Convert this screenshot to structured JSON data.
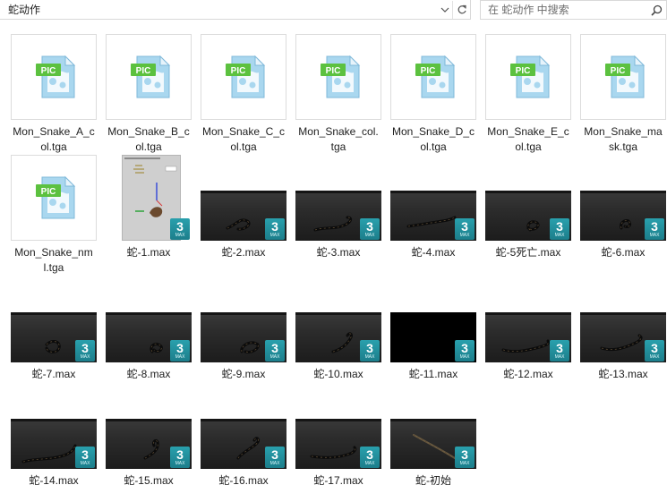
{
  "address_bar": {
    "path": "蛇动作"
  },
  "search": {
    "placeholder": "在 蛇动作 中搜索"
  },
  "icons": {
    "dropdown": "chevron-down-icon",
    "refresh": "refresh-icon",
    "search": "magnifier-icon",
    "image_file": "pic-file-icon",
    "max_badge": "3dsmax-badge-icon"
  },
  "colors": {
    "pic_badge": "#5cc13f",
    "max_badge": "#29a0ad",
    "file_icon": "#a9d7ef"
  },
  "badge": {
    "number": "3",
    "sub": "MAX"
  },
  "files": [
    {
      "name": "Mon_Snake_A_col.tga",
      "label_lines": [
        "Mon_Snake_A_c",
        "ol.tga"
      ],
      "kind": "pic",
      "pic_text": "PIC"
    },
    {
      "name": "Mon_Snake_B_col.tga",
      "label_lines": [
        "Mon_Snake_B_c",
        "ol.tga"
      ],
      "kind": "pic",
      "pic_text": "PIC"
    },
    {
      "name": "Mon_Snake_C_col.tga",
      "label_lines": [
        "Mon_Snake_C_c",
        "ol.tga"
      ],
      "kind": "pic",
      "pic_text": "PIC"
    },
    {
      "name": "Mon_Snake_col.tga",
      "label_lines": [
        "Mon_Snake_col.",
        "tga"
      ],
      "kind": "pic",
      "pic_text": "PIC"
    },
    {
      "name": "Mon_Snake_D_col.tga",
      "label_lines": [
        "Mon_Snake_D_c",
        "ol.tga"
      ],
      "kind": "pic",
      "pic_text": "PIC"
    },
    {
      "name": "Mon_Snake_E_col.tga",
      "label_lines": [
        "Mon_Snake_E_c",
        "ol.tga"
      ],
      "kind": "pic",
      "pic_text": "PIC"
    },
    {
      "name": "Mon_Snake_mask.tga",
      "label_lines": [
        "Mon_Snake_ma",
        "sk.tga"
      ],
      "kind": "pic",
      "pic_text": "PIC"
    },
    {
      "name": "Mon_Snake_nml.tga",
      "label_lines": [
        "Mon_Snake_nm",
        "l.tga"
      ],
      "kind": "pic",
      "pic_text": "PIC"
    },
    {
      "name": "蛇-1.max",
      "label_lines": [
        "蛇-1.max"
      ],
      "kind": "editor"
    },
    {
      "name": "蛇-2.max",
      "label_lines": [
        "蛇-2.max"
      ],
      "kind": "max",
      "pose": 0
    },
    {
      "name": "蛇-3.max",
      "label_lines": [
        "蛇-3.max"
      ],
      "kind": "max",
      "pose": 1
    },
    {
      "name": "蛇-4.max",
      "label_lines": [
        "蛇-4.max"
      ],
      "kind": "max",
      "pose": 2
    },
    {
      "name": "蛇-5死亡.max",
      "label_lines": [
        "蛇-5死亡.max"
      ],
      "kind": "max",
      "pose": 3
    },
    {
      "name": "蛇-6.max",
      "label_lines": [
        "蛇-6.max"
      ],
      "kind": "max",
      "pose": 4
    },
    {
      "name": "蛇-7.max",
      "label_lines": [
        "蛇-7.max"
      ],
      "kind": "max",
      "pose": 5
    },
    {
      "name": "蛇-8.max",
      "label_lines": [
        "蛇-8.max"
      ],
      "kind": "max",
      "pose": 6
    },
    {
      "name": "蛇-9.max",
      "label_lines": [
        "蛇-9.max"
      ],
      "kind": "max",
      "pose": 7
    },
    {
      "name": "蛇-10.max",
      "label_lines": [
        "蛇-10.max"
      ],
      "kind": "max",
      "pose": 8
    },
    {
      "name": "蛇-11.max",
      "label_lines": [
        "蛇-11.max"
      ],
      "kind": "max-black"
    },
    {
      "name": "蛇-12.max",
      "label_lines": [
        "蛇-12.max"
      ],
      "kind": "max",
      "pose": 9
    },
    {
      "name": "蛇-13.max",
      "label_lines": [
        "蛇-13.max"
      ],
      "kind": "max",
      "pose": 10
    },
    {
      "name": "蛇-14.max",
      "label_lines": [
        "蛇-14.max"
      ],
      "kind": "max",
      "pose": 11
    },
    {
      "name": "蛇-15.max",
      "label_lines": [
        "蛇-15.max"
      ],
      "kind": "max",
      "pose": 12
    },
    {
      "name": "蛇-16.max",
      "label_lines": [
        "蛇-16.max"
      ],
      "kind": "max",
      "pose": 13
    },
    {
      "name": "蛇-17.max",
      "label_lines": [
        "蛇-17.max"
      ],
      "kind": "max",
      "pose": 14
    },
    {
      "name": "蛇-初始",
      "label_lines": [
        "蛇-初始"
      ],
      "kind": "max",
      "pose": 15
    }
  ]
}
